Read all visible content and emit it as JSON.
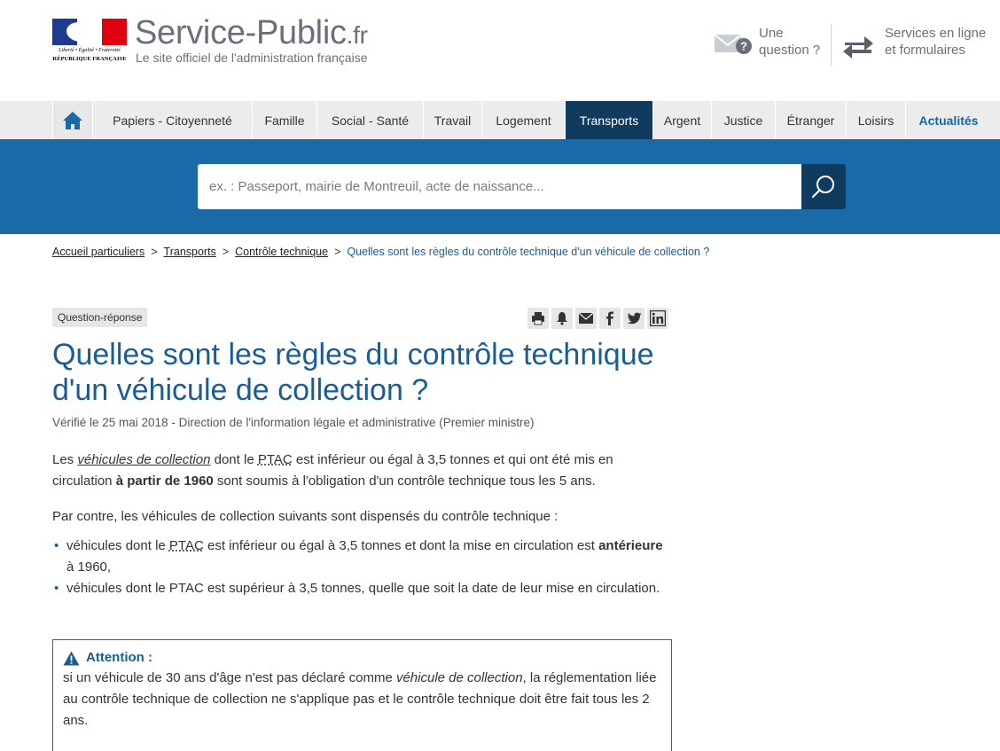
{
  "header": {
    "logo": {
      "motto": "Liberté • Égalité • Fraternité",
      "republique": "RÉPUBLIQUE FRANÇAISE",
      "flag_colors": [
        "#1f3a93",
        "#ffffff",
        "#e1000f"
      ]
    },
    "site_name": "Service-Public",
    "site_tld": ".fr",
    "tagline": "Le site officiel de l'administration française",
    "question_link": {
      "line1": "Une",
      "line2": "question ?",
      "icon": "mail-question-icon"
    },
    "services_link": {
      "line1": "Services en ligne",
      "line2": "et formulaires",
      "icon": "exchange-arrows-icon"
    }
  },
  "nav": {
    "home_icon": "home-icon",
    "items": [
      {
        "label": "Papiers - Citoyenneté"
      },
      {
        "label": "Famille"
      },
      {
        "label": "Social - Santé"
      },
      {
        "label": "Travail"
      },
      {
        "label": "Logement"
      },
      {
        "label": "Transports"
      },
      {
        "label": "Argent"
      },
      {
        "label": "Justice"
      },
      {
        "label": "Étranger"
      },
      {
        "label": "Loisirs"
      },
      {
        "label": "Actualités"
      }
    ],
    "active": "Transports"
  },
  "search": {
    "placeholder": "ex. : Passeport, mairie de Montreuil, acte de naissance...",
    "value": "",
    "button_icon": "search-icon"
  },
  "breadcrumb": {
    "items": [
      "Accueil particuliers",
      "Transports",
      "Contrôle technique"
    ],
    "separator": ">",
    "current": "Quelles sont les règles du contrôle technique d'un véhicule de collection ?"
  },
  "article": {
    "badge": "Question-réponse",
    "share_icons": [
      "print-icon",
      "bell-icon",
      "email-icon",
      "facebook-icon",
      "twitter-icon",
      "linkedin-icon"
    ],
    "title": "Quelles sont les règles du contrôle technique d'un véhicule de collection ?",
    "verified": "Vérifié le 25 mai 2018 - Direction de l'information légale et administrative (Premier ministre)",
    "p1": {
      "a": "Les ",
      "term": "véhicules de collection",
      "b": " dont le ",
      "abbr": "PTAC",
      "c": " est inférieur ou égal à 3,5 tonnes et qui ont été mis en circulation ",
      "strong": "à partir de 1960",
      "d": " sont soumis à l'obligation d'un contrôle technique tous les 5 ans."
    },
    "p2": "Par contre, les véhicules de collection suivants sont dispensés du contrôle technique :",
    "list": {
      "item1": {
        "a": "véhicules dont le ",
        "abbr": "PTAC",
        "b": " est inférieur ou égal à 3,5 tonnes et dont la mise en circulation est ",
        "strong": "antérieure",
        "c": " à 1960,"
      },
      "item2": "véhicules dont le PTAC est supérieur à 3,5 tonnes, quelle que soit la date de leur mise en circulation."
    },
    "attention": {
      "icon": "warning-icon",
      "heading": "Attention :",
      "a": "si un véhicule de 30 ans d'âge n'est pas déclaré comme ",
      "em": "véhicule de collection",
      "b": ", la réglementation liée au contrôle technique de collection ne s'applique pas et le contrôle technique doit être fait tous les 2 ans."
    }
  },
  "colors": {
    "primary_blue": "#1a6aa8",
    "dark_blue": "#0e3b5e",
    "title_blue": "#1a5c96",
    "nav_bg": "#ececec"
  }
}
